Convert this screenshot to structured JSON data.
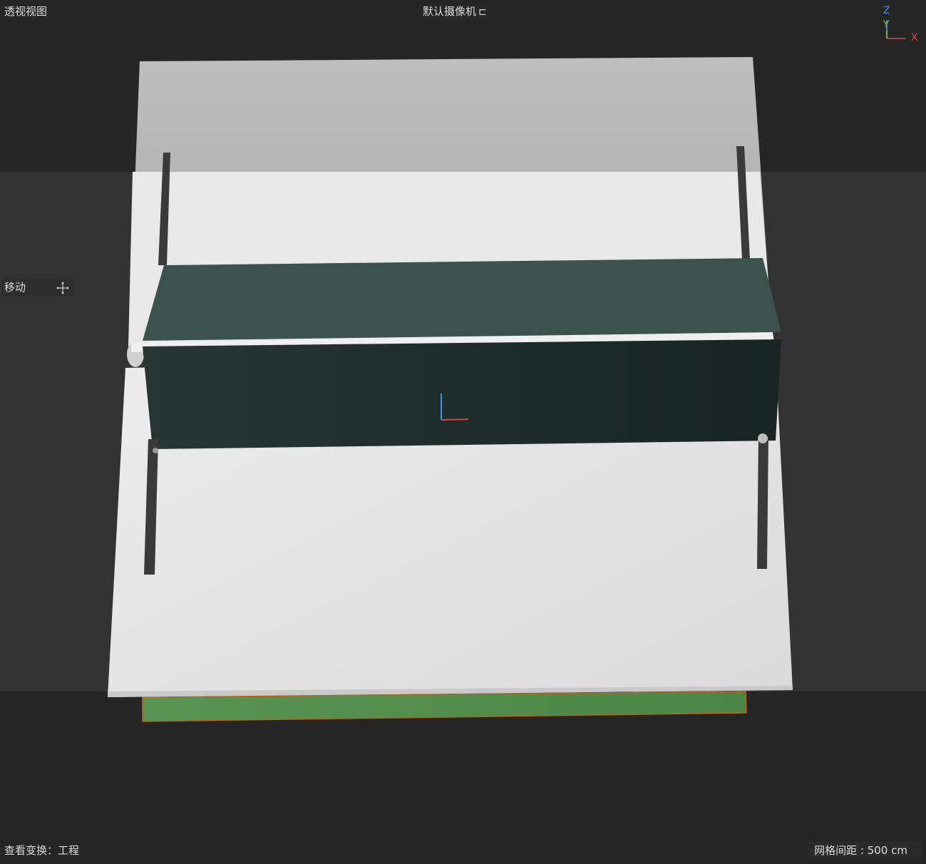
{
  "viewport": {
    "view_name": "透视视图",
    "camera_label": "默认摄像机",
    "camera_icon": "camera-switch-icon",
    "tool_label": "移动",
    "tool_icon": "move-arrows-icon",
    "view_transform": "查看变换：工程",
    "grid_spacing": "网格间距 : 500 cm"
  },
  "axis_gizmo": {
    "z_label": "Z",
    "y_label": "Y",
    "x_label": "X"
  },
  "colors": {
    "background": "#262626",
    "horizon_band": "#333333",
    "top_panel": "#b4b4b4",
    "floor_panel": "#e3e3e3",
    "box_top": "#3c524c",
    "box_front": "#1f2e2b",
    "ground_mat": "#508a4a",
    "axis_x": "#e84040",
    "axis_y": "#7ad24e",
    "axis_z": "#4a8cf0"
  }
}
